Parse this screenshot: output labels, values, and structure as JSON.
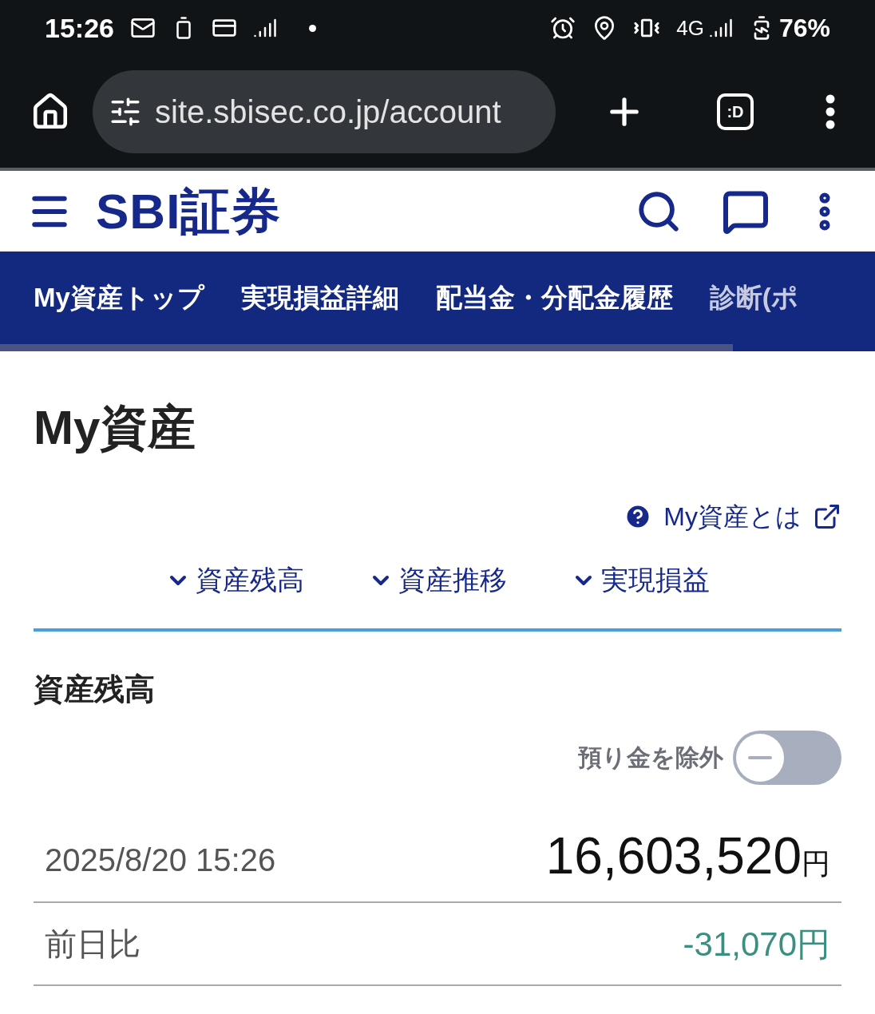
{
  "status_bar": {
    "time": "15:26",
    "network": "4G",
    "battery": "76%"
  },
  "browser": {
    "url": "site.sbisec.co.jp/account",
    "tab_icon": ":D"
  },
  "header": {
    "logo": "SBI証券"
  },
  "tabs": [
    {
      "label": "My資産トップ",
      "selected": false
    },
    {
      "label": "実現損益詳細",
      "selected": false
    },
    {
      "label": "配当金・分配金履歴",
      "selected": false
    },
    {
      "label": "診断(ポ",
      "selected": false
    }
  ],
  "page_title": "My資産",
  "help_link": "My資産とは",
  "section_links": [
    "資産残高",
    "資産推移",
    "実現損益"
  ],
  "section_title": "資産残高",
  "exclude_toggle": {
    "label": "預り金を除外",
    "on": false
  },
  "balance": {
    "datetime": "2025/8/20 15:26",
    "amount": "16,603,520",
    "unit": "円"
  },
  "change": {
    "label": "前日比",
    "value": "-31,070円"
  }
}
